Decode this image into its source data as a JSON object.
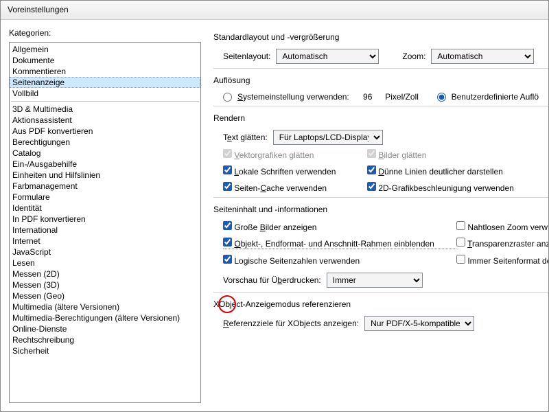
{
  "title": "Voreinstellungen",
  "categories_label": "Kategorien:",
  "categories_top": [
    "Allgemein",
    "Dokumente",
    "Kommentieren",
    "Seitenanzeige",
    "Vollbild"
  ],
  "categories_rest": [
    "3D & Multimedia",
    "Aktionsassistent",
    "Aus PDF konvertieren",
    "Berechtigungen",
    "Catalog",
    "Ein-/Ausgabehilfe",
    "Einheiten und Hilfslinien",
    "Farbmanagement",
    "Formulare",
    "Identität",
    "In PDF konvertieren",
    "International",
    "Internet",
    "JavaScript",
    "Lesen",
    "Messen (2D)",
    "Messen (3D)",
    "Messen (Geo)",
    "Multimedia (ältere Versionen)",
    "Multimedia-Berechtigungen (ältere Versionen)",
    "Online-Dienste",
    "Rechtschreibung",
    "Sicherheit"
  ],
  "selected_index": 3,
  "layout": {
    "title": "Standardlayout und -vergrößerung",
    "seitenlayout_label": "Seitenlayout:",
    "seitenlayout_value": "Automatisch",
    "zoom_label": "Zoom:",
    "zoom_value": "Automatisch"
  },
  "aufloesung": {
    "title": "Auflösung",
    "system_label": "Systemeinstellung verwenden:",
    "system_value": "96",
    "unit": "Pixel/Zoll",
    "custom_label": "Benutzerdefinierte Auflö"
  },
  "rendern": {
    "title": "Rendern",
    "text_glatten_label": "Text glätten:",
    "text_glatten_value": "Für Laptops/LCD-Displays",
    "vektor": "Vektorgrafiken glätten",
    "bilder": "Bilder glätten",
    "lokale": "Lokale Schriften verwenden",
    "duenne": "Dünne Linien deutlicher darstellen",
    "cache": "Seiten-Cache verwenden",
    "gpu": "2D-Grafikbeschleunigung verwenden"
  },
  "inhalt": {
    "title": "Seiteninhalt und -informationen",
    "grosse_bilder": "Große Bilder anzeigen",
    "nahtlos": "Nahtlosen Zoom verw",
    "rahmen": "Objekt-, Endformat- und Anschnitt-Rahmen einblenden",
    "transparenz": "Transparenzraster anze",
    "logische": "Logische Seitenzahlen verwenden",
    "seitenformat": "Immer Seitenformat de",
    "vorschau_label": "Vorschau für Überdrucken:",
    "vorschau_value": "Immer"
  },
  "xobject": {
    "title": "XObject-Anzeigemodus referenzieren",
    "ref_label": "Referenzziele für XObjects anzeigen:",
    "ref_value": "Nur PDF/X-5-kompatible"
  }
}
